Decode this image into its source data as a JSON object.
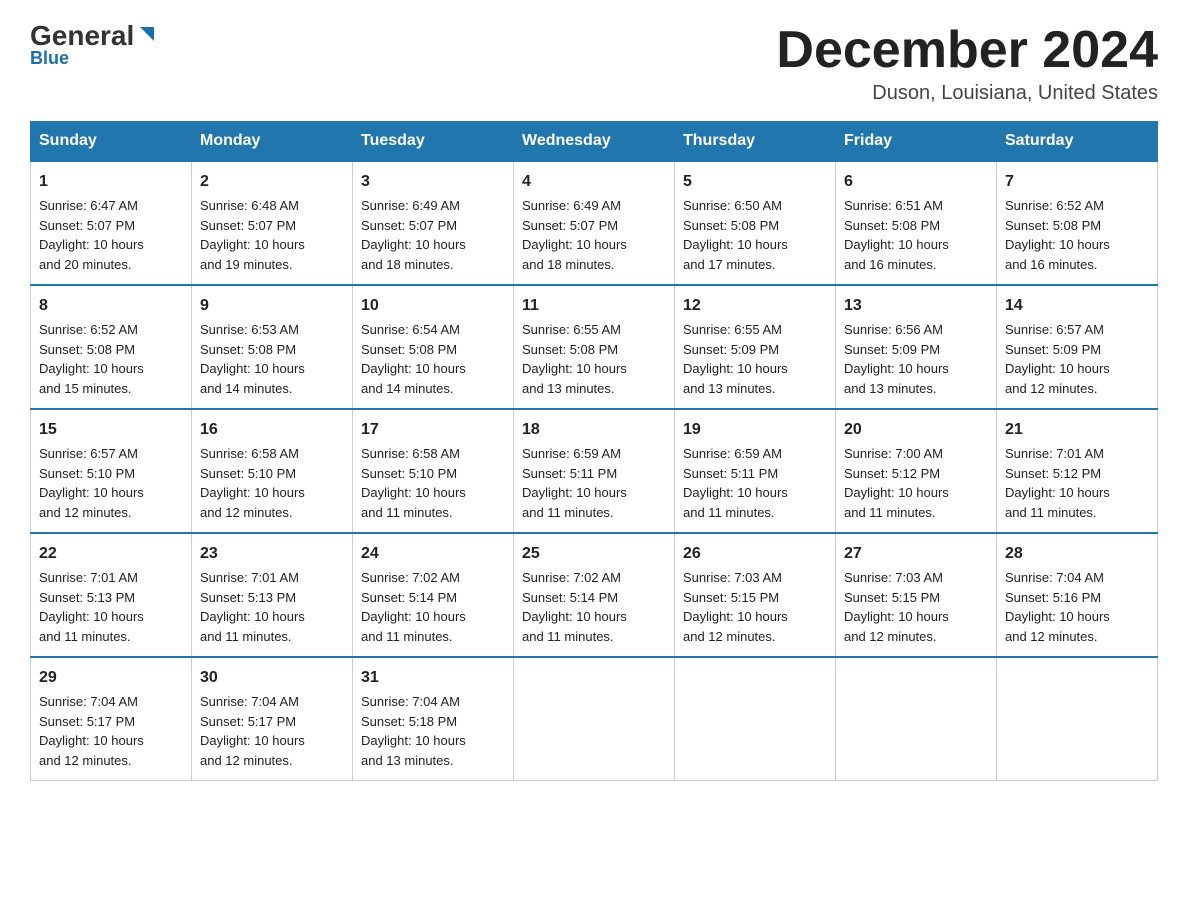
{
  "logo": {
    "text_general": "General",
    "text_blue": "Blue"
  },
  "title": "December 2024",
  "location": "Duson, Louisiana, United States",
  "weekdays": [
    "Sunday",
    "Monday",
    "Tuesday",
    "Wednesday",
    "Thursday",
    "Friday",
    "Saturday"
  ],
  "weeks": [
    [
      {
        "day": "1",
        "line1": "Sunrise: 6:47 AM",
        "line2": "Sunset: 5:07 PM",
        "line3": "Daylight: 10 hours",
        "line4": "and 20 minutes."
      },
      {
        "day": "2",
        "line1": "Sunrise: 6:48 AM",
        "line2": "Sunset: 5:07 PM",
        "line3": "Daylight: 10 hours",
        "line4": "and 19 minutes."
      },
      {
        "day": "3",
        "line1": "Sunrise: 6:49 AM",
        "line2": "Sunset: 5:07 PM",
        "line3": "Daylight: 10 hours",
        "line4": "and 18 minutes."
      },
      {
        "day": "4",
        "line1": "Sunrise: 6:49 AM",
        "line2": "Sunset: 5:07 PM",
        "line3": "Daylight: 10 hours",
        "line4": "and 18 minutes."
      },
      {
        "day": "5",
        "line1": "Sunrise: 6:50 AM",
        "line2": "Sunset: 5:08 PM",
        "line3": "Daylight: 10 hours",
        "line4": "and 17 minutes."
      },
      {
        "day": "6",
        "line1": "Sunrise: 6:51 AM",
        "line2": "Sunset: 5:08 PM",
        "line3": "Daylight: 10 hours",
        "line4": "and 16 minutes."
      },
      {
        "day": "7",
        "line1": "Sunrise: 6:52 AM",
        "line2": "Sunset: 5:08 PM",
        "line3": "Daylight: 10 hours",
        "line4": "and 16 minutes."
      }
    ],
    [
      {
        "day": "8",
        "line1": "Sunrise: 6:52 AM",
        "line2": "Sunset: 5:08 PM",
        "line3": "Daylight: 10 hours",
        "line4": "and 15 minutes."
      },
      {
        "day": "9",
        "line1": "Sunrise: 6:53 AM",
        "line2": "Sunset: 5:08 PM",
        "line3": "Daylight: 10 hours",
        "line4": "and 14 minutes."
      },
      {
        "day": "10",
        "line1": "Sunrise: 6:54 AM",
        "line2": "Sunset: 5:08 PM",
        "line3": "Daylight: 10 hours",
        "line4": "and 14 minutes."
      },
      {
        "day": "11",
        "line1": "Sunrise: 6:55 AM",
        "line2": "Sunset: 5:08 PM",
        "line3": "Daylight: 10 hours",
        "line4": "and 13 minutes."
      },
      {
        "day": "12",
        "line1": "Sunrise: 6:55 AM",
        "line2": "Sunset: 5:09 PM",
        "line3": "Daylight: 10 hours",
        "line4": "and 13 minutes."
      },
      {
        "day": "13",
        "line1": "Sunrise: 6:56 AM",
        "line2": "Sunset: 5:09 PM",
        "line3": "Daylight: 10 hours",
        "line4": "and 13 minutes."
      },
      {
        "day": "14",
        "line1": "Sunrise: 6:57 AM",
        "line2": "Sunset: 5:09 PM",
        "line3": "Daylight: 10 hours",
        "line4": "and 12 minutes."
      }
    ],
    [
      {
        "day": "15",
        "line1": "Sunrise: 6:57 AM",
        "line2": "Sunset: 5:10 PM",
        "line3": "Daylight: 10 hours",
        "line4": "and 12 minutes."
      },
      {
        "day": "16",
        "line1": "Sunrise: 6:58 AM",
        "line2": "Sunset: 5:10 PM",
        "line3": "Daylight: 10 hours",
        "line4": "and 12 minutes."
      },
      {
        "day": "17",
        "line1": "Sunrise: 6:58 AM",
        "line2": "Sunset: 5:10 PM",
        "line3": "Daylight: 10 hours",
        "line4": "and 11 minutes."
      },
      {
        "day": "18",
        "line1": "Sunrise: 6:59 AM",
        "line2": "Sunset: 5:11 PM",
        "line3": "Daylight: 10 hours",
        "line4": "and 11 minutes."
      },
      {
        "day": "19",
        "line1": "Sunrise: 6:59 AM",
        "line2": "Sunset: 5:11 PM",
        "line3": "Daylight: 10 hours",
        "line4": "and 11 minutes."
      },
      {
        "day": "20",
        "line1": "Sunrise: 7:00 AM",
        "line2": "Sunset: 5:12 PM",
        "line3": "Daylight: 10 hours",
        "line4": "and 11 minutes."
      },
      {
        "day": "21",
        "line1": "Sunrise: 7:01 AM",
        "line2": "Sunset: 5:12 PM",
        "line3": "Daylight: 10 hours",
        "line4": "and 11 minutes."
      }
    ],
    [
      {
        "day": "22",
        "line1": "Sunrise: 7:01 AM",
        "line2": "Sunset: 5:13 PM",
        "line3": "Daylight: 10 hours",
        "line4": "and 11 minutes."
      },
      {
        "day": "23",
        "line1": "Sunrise: 7:01 AM",
        "line2": "Sunset: 5:13 PM",
        "line3": "Daylight: 10 hours",
        "line4": "and 11 minutes."
      },
      {
        "day": "24",
        "line1": "Sunrise: 7:02 AM",
        "line2": "Sunset: 5:14 PM",
        "line3": "Daylight: 10 hours",
        "line4": "and 11 minutes."
      },
      {
        "day": "25",
        "line1": "Sunrise: 7:02 AM",
        "line2": "Sunset: 5:14 PM",
        "line3": "Daylight: 10 hours",
        "line4": "and 11 minutes."
      },
      {
        "day": "26",
        "line1": "Sunrise: 7:03 AM",
        "line2": "Sunset: 5:15 PM",
        "line3": "Daylight: 10 hours",
        "line4": "and 12 minutes."
      },
      {
        "day": "27",
        "line1": "Sunrise: 7:03 AM",
        "line2": "Sunset: 5:15 PM",
        "line3": "Daylight: 10 hours",
        "line4": "and 12 minutes."
      },
      {
        "day": "28",
        "line1": "Sunrise: 7:04 AM",
        "line2": "Sunset: 5:16 PM",
        "line3": "Daylight: 10 hours",
        "line4": "and 12 minutes."
      }
    ],
    [
      {
        "day": "29",
        "line1": "Sunrise: 7:04 AM",
        "line2": "Sunset: 5:17 PM",
        "line3": "Daylight: 10 hours",
        "line4": "and 12 minutes."
      },
      {
        "day": "30",
        "line1": "Sunrise: 7:04 AM",
        "line2": "Sunset: 5:17 PM",
        "line3": "Daylight: 10 hours",
        "line4": "and 12 minutes."
      },
      {
        "day": "31",
        "line1": "Sunrise: 7:04 AM",
        "line2": "Sunset: 5:18 PM",
        "line3": "Daylight: 10 hours",
        "line4": "and 13 minutes."
      },
      null,
      null,
      null,
      null
    ]
  ]
}
